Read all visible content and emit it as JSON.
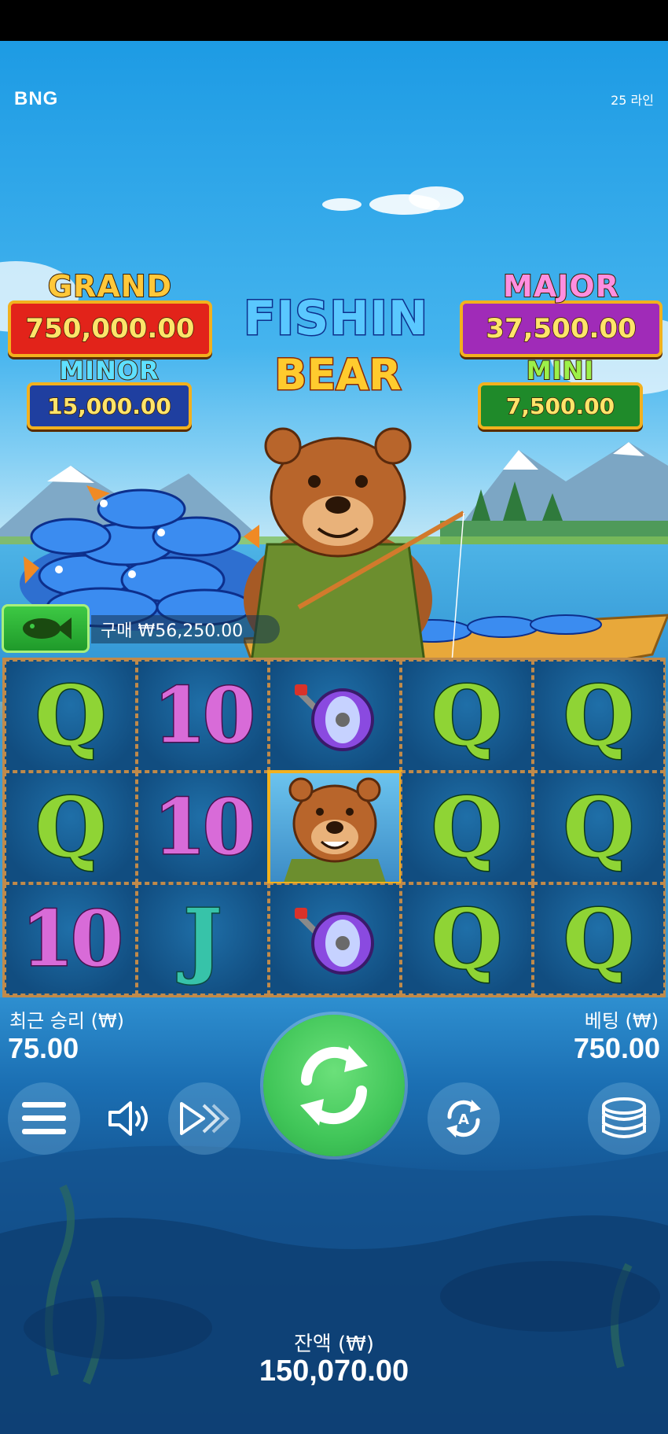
{
  "header": {
    "provider": "BNG",
    "lines": "25 라인"
  },
  "game": {
    "logo_line1": "FISHIN",
    "logo_line2": "BEAR"
  },
  "jackpots": {
    "grand": {
      "label": "GRAND",
      "value": "750,000.00"
    },
    "major": {
      "label": "MAJOR",
      "value": "37,500.00"
    },
    "minor": {
      "label": "MINOR",
      "value": "15,000.00"
    },
    "mini": {
      "label": "MINI",
      "value": "7,500.00"
    }
  },
  "buy_feature": {
    "label": "구매 ₩56,250.00",
    "icon": "fish-icon"
  },
  "reels": {
    "rows": [
      [
        "Q",
        "10",
        "reel-icon",
        "Q",
        "Q"
      ],
      [
        "Q",
        "10",
        "bear-icon",
        "Q",
        "Q"
      ],
      [
        "10",
        "J",
        "reel-icon",
        "Q",
        "Q"
      ]
    ]
  },
  "stats": {
    "last_win_label": "최근 승리 (₩)",
    "last_win_value": "75.00",
    "bet_label": "베팅 (₩)",
    "bet_value": "750.00",
    "balance_label": "잔액 (₩)",
    "balance_value": "150,070.00"
  },
  "controls": {
    "menu_icon": "menu-icon",
    "sound_icon": "sound-icon",
    "turbo_icon": "turbo-icon",
    "spin_icon": "spin-icon",
    "autoplay_icon": "autoplay-icon",
    "bet_icon": "coins-icon"
  },
  "colors": {
    "grand": "#e2231a",
    "major": "#a02bb8",
    "minor": "#1f3fa0",
    "mini": "#1f8a2a",
    "spin": "#41c659",
    "grid_border": "#c08a4a"
  }
}
